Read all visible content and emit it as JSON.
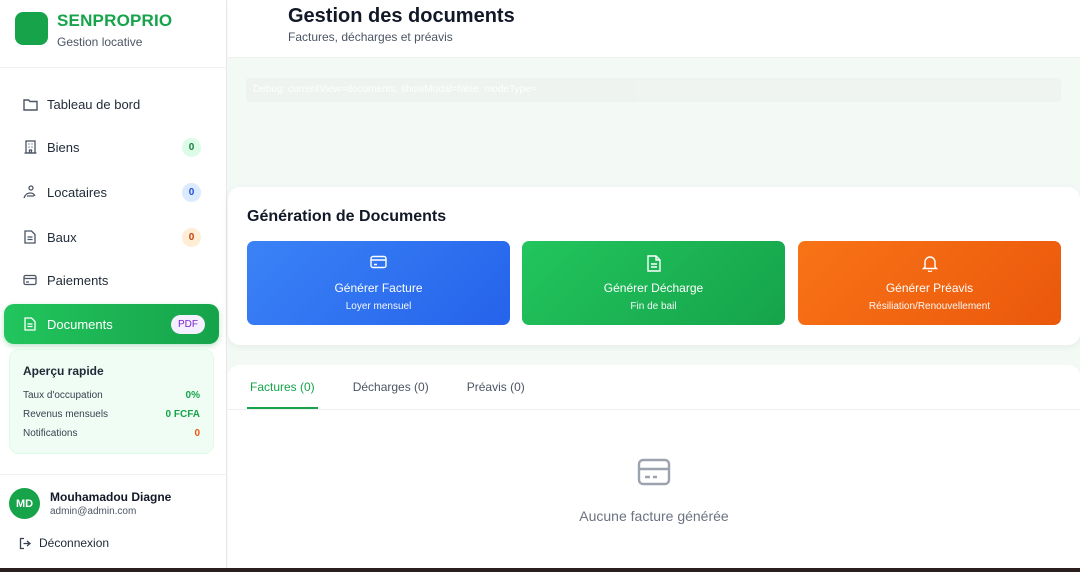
{
  "brand": {
    "name": "SENPROPRIO",
    "subtitle": "Gestion locative"
  },
  "sidebar": {
    "items": [
      {
        "label": "Tableau de bord",
        "icon": "folder-icon"
      },
      {
        "label": "Biens",
        "icon": "building-icon",
        "badge": "0"
      },
      {
        "label": "Locataires",
        "icon": "user-walk-icon",
        "badge": "0"
      },
      {
        "label": "Baux",
        "icon": "document-icon",
        "badge": "0"
      },
      {
        "label": "Paiements",
        "icon": "credit-card-icon"
      },
      {
        "label": "Documents",
        "icon": "document-icon",
        "badge": "PDF",
        "active": true
      }
    ],
    "quick": {
      "title": "Aperçu rapide",
      "rows": [
        {
          "label": "Taux d'occupation",
          "value": "0%"
        },
        {
          "label": "Revenus mensuels",
          "value": "0 FCFA"
        },
        {
          "label": "Notifications",
          "value": "0"
        }
      ]
    },
    "user": {
      "initials": "MD",
      "name": "Mouhamadou Diagne",
      "email": "admin@admin.com"
    },
    "logout": "Déconnexion"
  },
  "header": {
    "title": "Gestion des documents",
    "subtitle": "Factures, décharges et préavis"
  },
  "debug": "Debug: currentView=documents, showModal=false, modeType=",
  "generation": {
    "title": "Génération de Documents",
    "buttons": [
      {
        "title": "Générer Facture",
        "subtitle": "Loyer mensuel",
        "icon": "credit-card-icon",
        "color": "#2563eb"
      },
      {
        "title": "Générer Décharge",
        "subtitle": "Fin de bail",
        "icon": "document-icon",
        "color": "#16a34a"
      },
      {
        "title": "Générer Préavis",
        "subtitle": "Résiliation/Renouvellement",
        "icon": "bell-icon",
        "color": "#ea580c"
      }
    ]
  },
  "tabs": [
    {
      "label": "Factures (0)",
      "active": true
    },
    {
      "label": "Décharges (0)"
    },
    {
      "label": "Préavis (0)"
    }
  ],
  "empty": {
    "text": "Aucune facture générée",
    "icon": "credit-card-icon"
  },
  "colors": {
    "accent": "#16a34a",
    "blue": "#2563eb",
    "orange": "#ea580c"
  }
}
